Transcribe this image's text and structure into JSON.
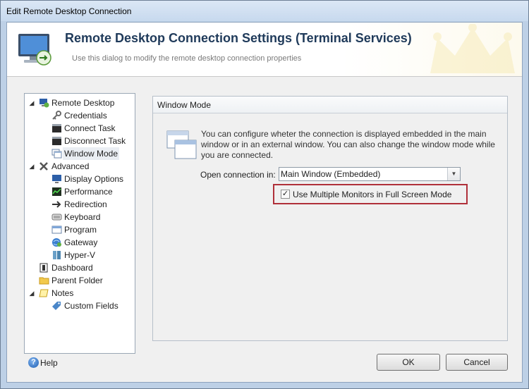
{
  "window": {
    "title": "Edit Remote Desktop Connection"
  },
  "header": {
    "title": "Remote Desktop Connection Settings (Terminal Services)",
    "subtitle": "Use this dialog to modify the remote desktop connection properties"
  },
  "tree": {
    "items": [
      {
        "label": "Remote Desktop",
        "icon": "remote-desktop-icon",
        "expanded": true
      },
      {
        "label": "Credentials",
        "icon": "key-icon"
      },
      {
        "label": "Connect Task",
        "icon": "console-icon"
      },
      {
        "label": "Disconnect Task",
        "icon": "console-icon"
      },
      {
        "label": "Window Mode",
        "icon": "windows-icon",
        "selected": true
      },
      {
        "label": "Advanced",
        "icon": "tools-icon",
        "expanded": true
      },
      {
        "label": "Display Options",
        "icon": "monitor-icon"
      },
      {
        "label": "Performance",
        "icon": "performance-icon"
      },
      {
        "label": "Redirection",
        "icon": "redirect-icon"
      },
      {
        "label": "Keyboard",
        "icon": "keyboard-icon"
      },
      {
        "label": "Program",
        "icon": "program-icon"
      },
      {
        "label": "Gateway",
        "icon": "gateway-icon"
      },
      {
        "label": "Hyper-V",
        "icon": "server-icon"
      },
      {
        "label": "Dashboard",
        "icon": "dashboard-icon"
      },
      {
        "label": "Parent Folder",
        "icon": "folder-icon"
      },
      {
        "label": "Notes",
        "icon": "notes-icon",
        "expanded": true
      },
      {
        "label": "Custom Fields",
        "icon": "tag-icon"
      }
    ]
  },
  "panel": {
    "title": "Window Mode",
    "description": "You can configure wheter the connection is displayed embedded in the main window or in an external window. You can also change the window mode while you are connected.",
    "open_label": "Open connection in:",
    "open_value": "Main Window (Embedded)",
    "multi_monitor_label": "Use Multiple Monitors in Full Screen Mode",
    "multi_monitor_checked": true
  },
  "footer": {
    "help": "Help",
    "ok": "OK",
    "cancel": "Cancel"
  },
  "colors": {
    "highlight_border": "#b0303a",
    "title_text": "#1f3a5a"
  }
}
